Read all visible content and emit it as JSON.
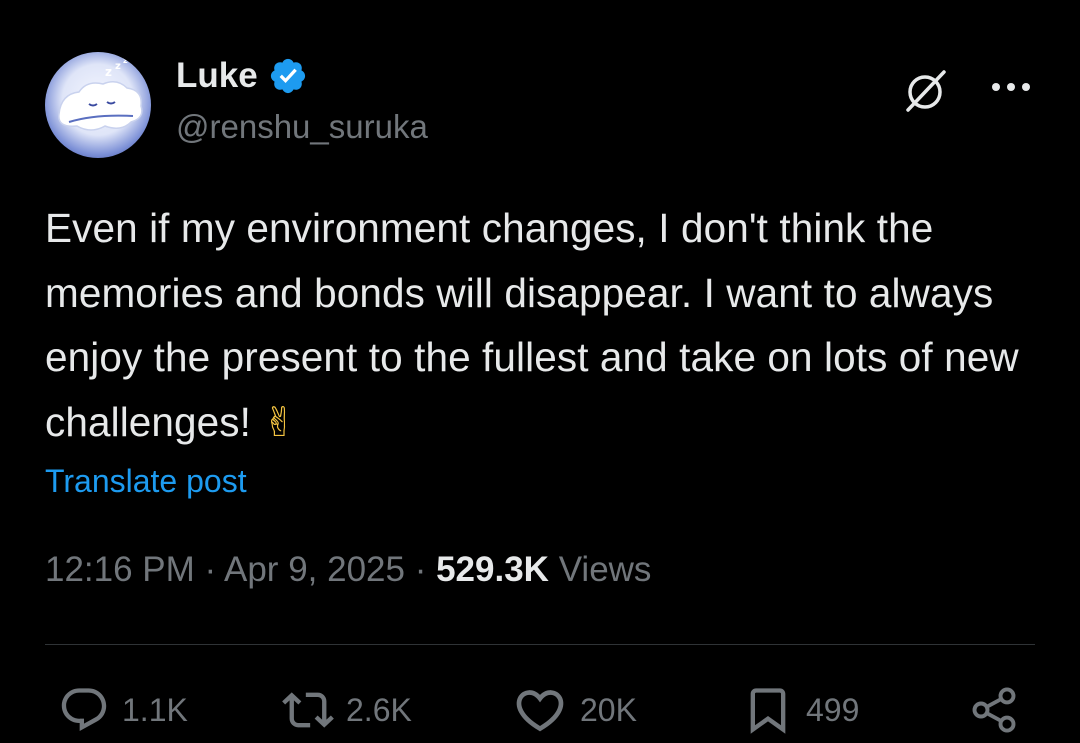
{
  "author": {
    "display_name": "Luke",
    "handle": "@renshu_suruka",
    "verified": true,
    "avatar_icon": "sleeping-cloud-avatar"
  },
  "header_actions": {
    "grok_icon": "grok-icon",
    "more_icon": "more-horizontal-icon"
  },
  "post": {
    "text": "Even if my environment changes, I don't think the memories and bonds will disappear. I want to always enjoy the present to the fullest and take on lots of new challenges!",
    "emoji": "✌",
    "translate_label": "Translate post"
  },
  "meta": {
    "time": "12:16 PM",
    "separator": "·",
    "date": "Apr 9, 2025",
    "views_count": "529.3K",
    "views_label": "Views"
  },
  "actions": {
    "replies": "1.1K",
    "reposts": "2.6K",
    "likes": "20K",
    "bookmarks": "499"
  },
  "colors": {
    "background": "#000000",
    "text": "#e7e9ea",
    "muted": "#71767b",
    "link": "#1d9bf0",
    "verified": "#1d9bf0",
    "divider": "#2f3336"
  }
}
